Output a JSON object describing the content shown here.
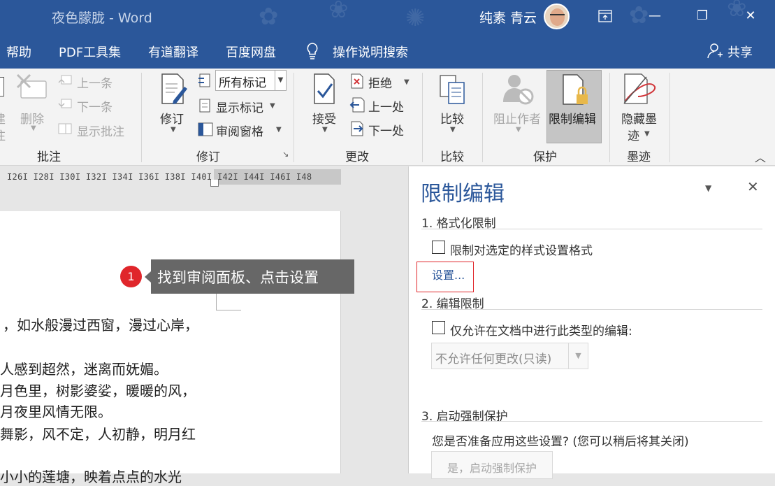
{
  "titlebar": {
    "title": "夜色朦胧  -  Word",
    "user": "纯素 青云",
    "minimize_glyph": "—",
    "restore_glyph": "❐",
    "close_glyph": "✕",
    "icons": [
      "ribbon-display-icon"
    ]
  },
  "menu": {
    "help": "帮助",
    "pdf": "PDF工具集",
    "youdao": "有道翻译",
    "baidu": "百度网盘",
    "search": "操作说明搜索",
    "share": "共享"
  },
  "ribbon": {
    "comments": {
      "label": "批注",
      "delete": "删除",
      "prev": "上一条",
      "next": "下一条",
      "show": "显示批注",
      "partial_char1": "建",
      "partial_char2": "注"
    },
    "tracking": {
      "label": "修订",
      "track": "修订",
      "markup_select": "所有标记",
      "show_markup": "显示标记",
      "review_pane": "审阅窗格"
    },
    "changes": {
      "label": "更改",
      "accept": "接受",
      "reject": "拒绝",
      "prev": "上一处",
      "next": "下一处"
    },
    "compare": {
      "label": "比较",
      "compare": "比较"
    },
    "protect": {
      "label": "保护",
      "block_authors": "阻止作者",
      "restrict_editing": "限制编辑"
    },
    "ink": {
      "label": "墨迹",
      "hide_ink_line1": "隐藏墨",
      "hide_ink_line2": "迹"
    }
  },
  "ruler": {
    "ticks": "I26I  I28I  I30I  I32I  I34I  I36I  I38I  I40I  I42I  I44I  I46I  I48"
  },
  "document": {
    "lines": [
      "，如水般漫过西窗，漫过心岸，",
      "人感到超然，迷离而妩媚。",
      "月色里，树影婆娑，暖暖的风，",
      "月夜里风情无限。",
      "舞影，风不定，人初静，明月红",
      "小小的莲塘，映着点点的水光"
    ]
  },
  "callout": {
    "number": "1",
    "text": "找到审阅面板、点击设置"
  },
  "pane": {
    "title": "限制编辑",
    "section1": "1. 格式化限制",
    "format_check": "限制对选定的样式设置格式",
    "settings_link": "设置...",
    "section2": "2. 编辑限制",
    "edit_check": "仅允许在文档中进行此类型的编辑:",
    "edit_dropdown": "不允许任何更改(只读)",
    "section3": "3. 启动强制保护",
    "question": "您是否准备应用这些设置? (您可以稍后将其关闭)",
    "enforce_button": "是，启动强制保护"
  },
  "colors": {
    "word_blue": "#2b579a",
    "callout_red": "#e0262b",
    "callout_bg": "#676767"
  }
}
